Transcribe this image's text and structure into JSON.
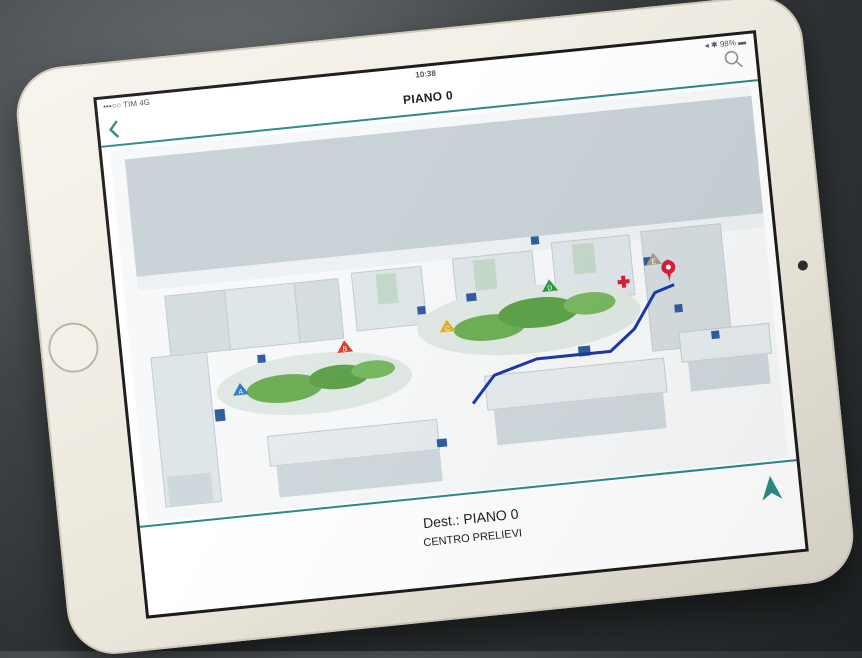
{
  "status_bar": {
    "carrier": "•••○○ TIM 4G",
    "time": "10:38",
    "battery": "◂ ✱ 98% ▬"
  },
  "header": {
    "title": "PIANO 0",
    "back_icon": "chevron-left-icon",
    "search_icon": "search-icon"
  },
  "map": {
    "markers": [
      {
        "name": "marker-a",
        "letter": "A",
        "color": "#2f7fc1"
      },
      {
        "name": "marker-b",
        "letter": "B",
        "color": "#d8412f"
      },
      {
        "name": "marker-c",
        "letter": "C",
        "color": "#e3b11c"
      },
      {
        "name": "marker-d",
        "letter": "D",
        "color": "#2e9a45"
      },
      {
        "name": "marker-e",
        "letter": "E",
        "color": "#a99b8e"
      }
    ],
    "route_color": "#1a3aa6",
    "destination_pin_color": "#d91f3a",
    "accent_color": "#2c8a86"
  },
  "footer": {
    "destination_label": "Dest.: PIANO 0",
    "destination_name": "CENTRO PRELIEVI",
    "navigate_icon": "navigation-arrow-icon"
  }
}
